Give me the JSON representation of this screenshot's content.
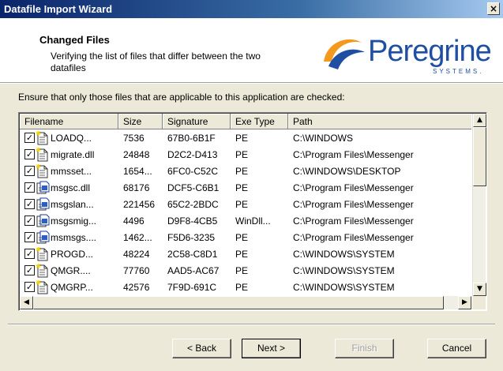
{
  "window": {
    "title": "Datafile Import Wizard",
    "close_glyph": "×"
  },
  "header": {
    "title": "Changed Files",
    "subtitle": "Verifying the list of files that differ between the two datafiles",
    "logo": {
      "name": "Peregrine",
      "sub": "SYSTEMS."
    }
  },
  "instruction": "Ensure that only those files that are applicable to this application are checked:",
  "columns": [
    "Filename",
    "Size",
    "Signature",
    "Exe Type",
    "Path"
  ],
  "rows": [
    {
      "checked": true,
      "icon": "file-new-icon",
      "filename": "LOADQ...",
      "size": "7536",
      "signature": "67B0-6B1F",
      "exe_type": "PE",
      "path": "C:\\WINDOWS"
    },
    {
      "checked": true,
      "icon": "file-new-icon",
      "filename": "migrate.dll",
      "size": "24848",
      "signature": "D2C2-D413",
      "exe_type": "PE",
      "path": "C:\\Program Files\\Messenger"
    },
    {
      "checked": true,
      "icon": "file-new-icon",
      "filename": "mmsset...",
      "size": "1654...",
      "signature": "6FC0-C52C",
      "exe_type": "PE",
      "path": "C:\\WINDOWS\\DESKTOP"
    },
    {
      "checked": true,
      "icon": "file-copy-icon",
      "filename": "msgsc.dll",
      "size": "68176",
      "signature": "DCF5-C6B1",
      "exe_type": "PE",
      "path": "C:\\Program Files\\Messenger"
    },
    {
      "checked": true,
      "icon": "file-copy-icon",
      "filename": "msgslan...",
      "size": "221456",
      "signature": "65C2-2BDC",
      "exe_type": "PE",
      "path": "C:\\Program Files\\Messenger"
    },
    {
      "checked": true,
      "icon": "file-copy-icon",
      "filename": "msgsmig...",
      "size": "4496",
      "signature": "D9F8-4CB5",
      "exe_type": "WinDll...",
      "path": "C:\\Program Files\\Messenger"
    },
    {
      "checked": true,
      "icon": "file-copy-icon",
      "filename": "msmsgs....",
      "size": "1462...",
      "signature": "F5D6-3235",
      "exe_type": "PE",
      "path": "C:\\Program Files\\Messenger"
    },
    {
      "checked": true,
      "icon": "file-new-icon",
      "filename": "PROGD...",
      "size": "48224",
      "signature": "2C58-C8D1",
      "exe_type": "PE",
      "path": "C:\\WINDOWS\\SYSTEM"
    },
    {
      "checked": true,
      "icon": "file-new-icon",
      "filename": "QMGR....",
      "size": "77760",
      "signature": "AAD5-AC67",
      "exe_type": "PE",
      "path": "C:\\WINDOWS\\SYSTEM"
    },
    {
      "checked": true,
      "icon": "file-new-icon",
      "filename": "QMGRP...",
      "size": "42576",
      "signature": "7F9D-691C",
      "exe_type": "PE",
      "path": "C:\\WINDOWS\\SYSTEM"
    }
  ],
  "buttons": {
    "back": "< Back",
    "next": "Next >",
    "finish": "Finish",
    "cancel": "Cancel"
  },
  "colors": {
    "title_bar": "#0a246a",
    "logo_blue": "#1f4fa3",
    "logo_orange": "#f39a1e",
    "face": "#ece9d8"
  }
}
